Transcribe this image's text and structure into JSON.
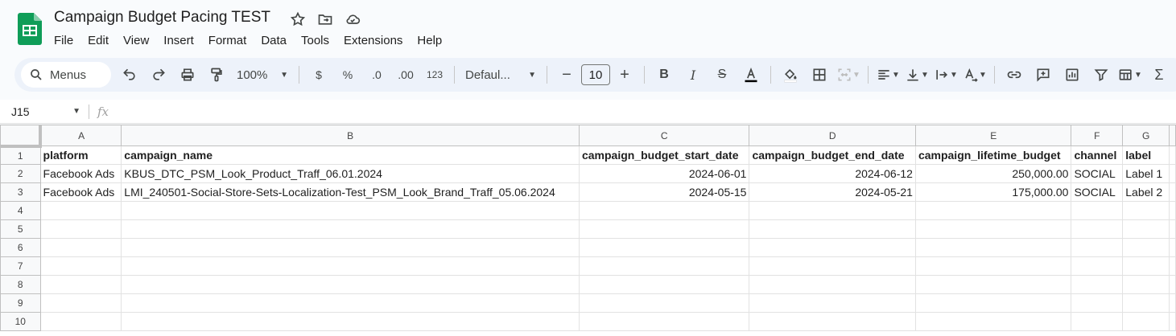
{
  "header": {
    "title": "Campaign Budget Pacing TEST",
    "menu": [
      "File",
      "Edit",
      "View",
      "Insert",
      "Format",
      "Data",
      "Tools",
      "Extensions",
      "Help"
    ]
  },
  "toolbar": {
    "search_label": "Menus",
    "zoom": "100%",
    "currency": "$",
    "percent": "%",
    "dec_decrease": ".0",
    "dec_increase": ".00",
    "number_format": "123",
    "font": "Defaul...",
    "font_size": "10"
  },
  "formula_bar": {
    "cell_ref": "J15",
    "fx": "fx",
    "value": ""
  },
  "sheet": {
    "columns": [
      "A",
      "B",
      "C",
      "D",
      "E",
      "F",
      "G"
    ],
    "rows": [
      [
        "platform",
        "campaign_name",
        "campaign_budget_start_date",
        "campaign_budget_end_date",
        "campaign_lifetime_budget",
        "channel",
        "label"
      ],
      [
        "Facebook Ads",
        "KBUS_DTC_PSM_Look_Product_Traff_06.01.2024",
        "2024-06-01",
        "2024-06-12",
        "250,000.00",
        "SOCIAL",
        "Label 1"
      ],
      [
        "Facebook Ads",
        "LMI_240501-Social-Store-Sets-Localization-Test_PSM_Look_Brand_Traff_05.06.2024",
        "2024-05-15",
        "2024-05-21",
        "175,000.00",
        "SOCIAL",
        "Label 2"
      ],
      [
        "",
        "",
        "",
        "",
        "",
        "",
        ""
      ],
      [
        "",
        "",
        "",
        "",
        "",
        "",
        ""
      ],
      [
        "",
        "",
        "",
        "",
        "",
        "",
        ""
      ],
      [
        "",
        "",
        "",
        "",
        "",
        "",
        ""
      ],
      [
        "",
        "",
        "",
        "",
        "",
        "",
        ""
      ],
      [
        "",
        "",
        "",
        "",
        "",
        "",
        ""
      ],
      [
        "",
        "",
        "",
        "",
        "",
        "",
        ""
      ]
    ],
    "row_numbers": [
      "1",
      "2",
      "3",
      "4",
      "5",
      "6",
      "7",
      "8",
      "9",
      "10"
    ]
  },
  "colors": {
    "toolbar_bg": "#edf2fa",
    "sheets_green": "#0f9d58"
  }
}
